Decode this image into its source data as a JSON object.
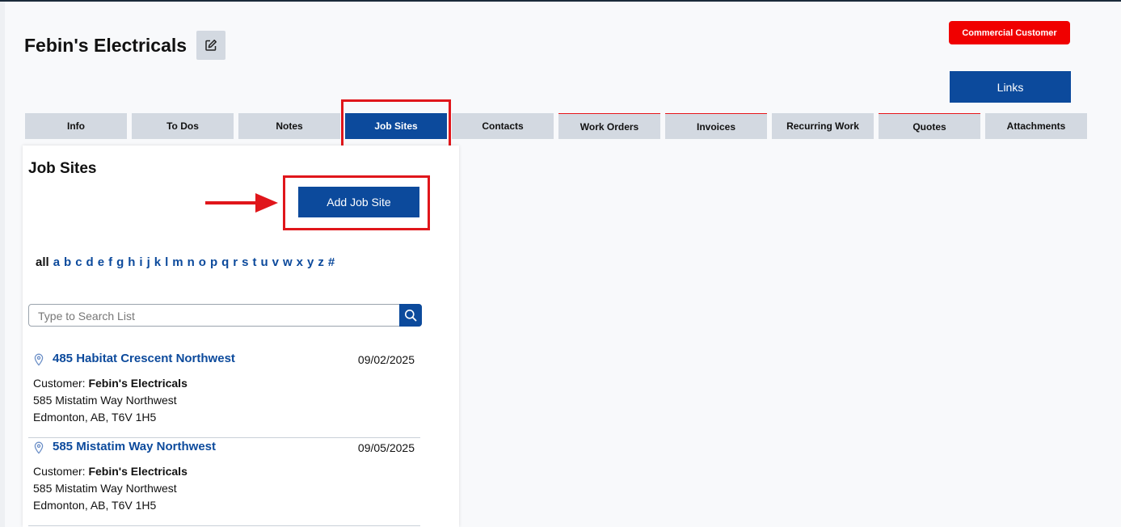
{
  "header": {
    "title": "Febin's Electricals",
    "badge": "Commercial Customer",
    "links_label": "Links"
  },
  "tabs": [
    {
      "label": "Info"
    },
    {
      "label": "To Dos"
    },
    {
      "label": "Notes"
    },
    {
      "label": "Job Sites",
      "active": true
    },
    {
      "label": "Contacts"
    },
    {
      "label": "Work Orders"
    },
    {
      "label": "Invoices"
    },
    {
      "label": "Recurring Work"
    },
    {
      "label": "Quotes"
    },
    {
      "label": "Attachments"
    }
  ],
  "panel": {
    "title": "Job Sites",
    "add_label": "Add Job Site",
    "alpha": [
      "all",
      "a",
      "b",
      "c",
      "d",
      "e",
      "f",
      "g",
      "h",
      "i",
      "j",
      "k",
      "l",
      "m",
      "n",
      "o",
      "p",
      "q",
      "r",
      "s",
      "t",
      "u",
      "v",
      "w",
      "x",
      "y",
      "z",
      "#"
    ],
    "search_placeholder": "Type to Search List",
    "items": [
      {
        "name": "485 Habitat Crescent Northwest",
        "date": "09/02/2025",
        "customer_label": "Customer:",
        "customer": "Febin's Electricals",
        "line1": "585 Mistatim Way Northwest",
        "line2": "Edmonton, AB, T6V 1H5"
      },
      {
        "name": "585 Mistatim Way Northwest",
        "date": "09/05/2025",
        "customer_label": "Customer:",
        "customer": "Febin's Electricals",
        "line1": "585 Mistatim Way Northwest",
        "line2": "Edmonton, AB, T6V 1H5"
      }
    ]
  },
  "colors": {
    "primary": "#0c4a9c",
    "badge": "#f00000",
    "annotation": "#e0161b",
    "tab_bg": "#d3d9e1"
  },
  "icons": {
    "edit": "edit-icon",
    "search": "search-icon",
    "pin": "map-pin-icon",
    "arrow": "arrow-right-icon"
  }
}
